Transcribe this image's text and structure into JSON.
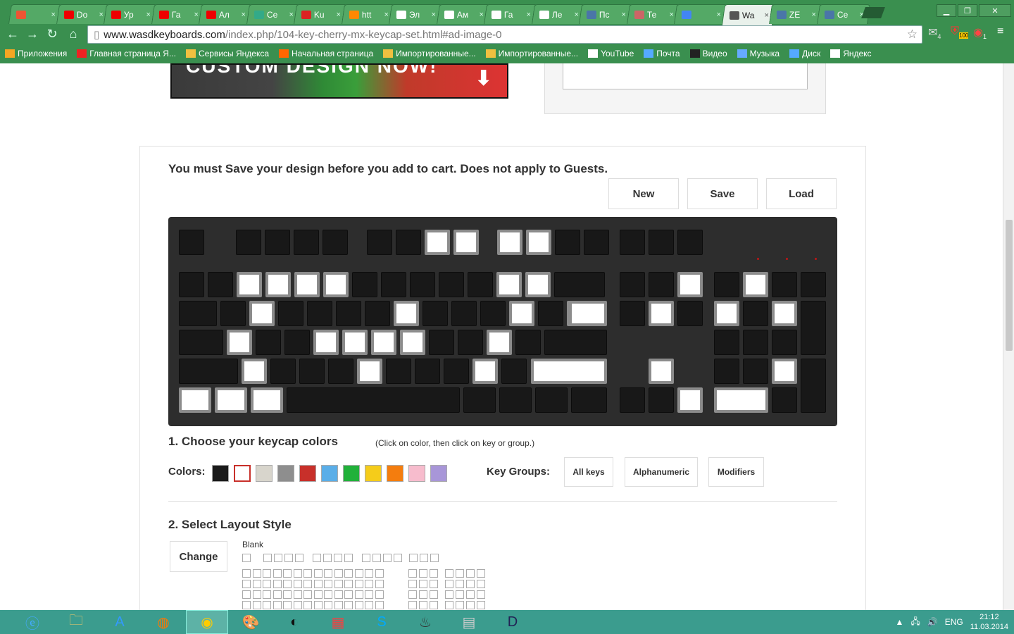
{
  "browser": {
    "tabs": [
      {
        "title": "",
        "color": "#e53"
      },
      {
        "title": "Do",
        "color": "#e00"
      },
      {
        "title": "Ур",
        "color": "#e00"
      },
      {
        "title": "Га",
        "color": "#e00"
      },
      {
        "title": "Ал",
        "color": "#e00"
      },
      {
        "title": "Се",
        "color": "#3a8"
      },
      {
        "title": "Ku",
        "color": "#d22"
      },
      {
        "title": "htt",
        "color": "#f80"
      },
      {
        "title": "Эл",
        "color": "#fff"
      },
      {
        "title": "Ам",
        "color": "#fff"
      },
      {
        "title": "Га",
        "color": "#fff"
      },
      {
        "title": "Ле",
        "color": "#fff"
      },
      {
        "title": "Пс",
        "color": "#4a76a8"
      },
      {
        "title": "Те",
        "color": "#c66"
      },
      {
        "title": "",
        "color": "#4285f4"
      },
      {
        "title": "Wa",
        "color": "#555",
        "active": true
      },
      {
        "title": "ZE",
        "color": "#4a76a8"
      },
      {
        "title": "Се",
        "color": "#4a76a8"
      }
    ],
    "url_host": "www.wasdkeyboards.com",
    "url_path": "/index.php/104-key-cherry-mx-keycap-set.html#ad-image-0",
    "ext_badges": [
      "4",
      "100",
      "1"
    ]
  },
  "bookmarks": [
    {
      "label": "Приложения",
      "icon": "apps-icon"
    },
    {
      "label": "Главная страница Я...",
      "icon": "yandex-icon"
    },
    {
      "label": "Сервисы Яндекса",
      "icon": "folder-icon"
    },
    {
      "label": "Начальная страница",
      "icon": "firefox-icon"
    },
    {
      "label": "Импортированные...",
      "icon": "folder-icon"
    },
    {
      "label": "Импортированные...",
      "icon": "folder-icon"
    },
    {
      "label": "YouTube",
      "icon": "page-icon"
    },
    {
      "label": "Почта",
      "icon": "mail-icon"
    },
    {
      "label": "Видео",
      "icon": "video-icon"
    },
    {
      "label": "Музыка",
      "icon": "music-icon"
    },
    {
      "label": "Диск",
      "icon": "disk-icon"
    },
    {
      "label": "Яндекс",
      "icon": "page-icon"
    }
  ],
  "designer": {
    "notice": "You must Save your design before you add to cart. Does not apply to Guests.",
    "actions": [
      "New",
      "Save",
      "Load"
    ],
    "step1_title": "1. Choose your keycap colors",
    "step1_hint": "(Click on color, then click on key or group.)",
    "colors_label": "Colors:",
    "colors": [
      "#1a1a1a",
      "#ffffff",
      "#d8d5cc",
      "#8e8e8e",
      "#c8302a",
      "#5aaee8",
      "#21b13a",
      "#f5cc1a",
      "#f47d0e",
      "#f7bccd",
      "#a896d8"
    ],
    "selected_color": 1,
    "key_groups_label": "Key Groups:",
    "key_groups": [
      "All keys",
      "Alphanumeric",
      "Modifiers"
    ],
    "step2_title": "2. Select Layout Style",
    "change_label": "Change",
    "layout_name": "Blank"
  },
  "taskbar": {
    "apps": [
      "ie-icon",
      "explorer-icon",
      "wordpad-icon",
      "firefox-icon",
      "chrome-icon",
      "paint-icon",
      "obs-icon",
      "apps-icon",
      "skype-icon",
      "steam-icon",
      "calculator-icon",
      "diablo-icon"
    ],
    "active_app": 4,
    "lang": "ENG",
    "time": "21:12",
    "date": "11.03.2014"
  }
}
